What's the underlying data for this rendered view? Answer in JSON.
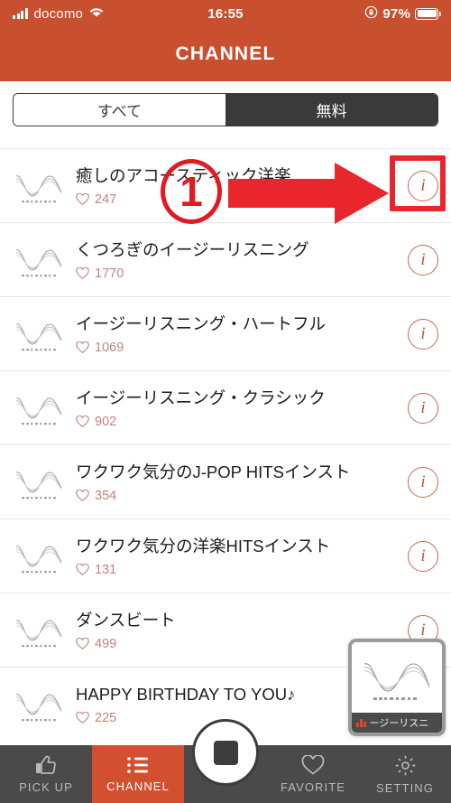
{
  "status_bar": {
    "carrier": "docomo",
    "time": "16:55",
    "battery_percent": "97%",
    "signal_icon": "signal-bars-icon",
    "wifi_icon": "wifi-icon",
    "rotation_lock_icon": "rotation-lock-icon",
    "battery_icon": "battery-icon"
  },
  "header": {
    "title": "CHANNEL"
  },
  "segmented": {
    "selected": "すべて",
    "options": [
      {
        "label": "すべて",
        "selected": true
      },
      {
        "label": "無料",
        "selected": false
      }
    ]
  },
  "channels": [
    {
      "title": "癒しのアコースティック洋楽",
      "likes": "247",
      "info_label": "i"
    },
    {
      "title": "くつろぎのイージーリスニング",
      "likes": "1770",
      "info_label": "i"
    },
    {
      "title": "イージーリスニング・ハートフル",
      "likes": "1069",
      "info_label": "i"
    },
    {
      "title": "イージーリスニング・クラシック",
      "likes": "902",
      "info_label": "i"
    },
    {
      "title": "ワクワク気分のJ-POP HITSインスト",
      "likes": "354",
      "info_label": "i"
    },
    {
      "title": "ワクワク気分の洋楽HITSインスト",
      "likes": "131",
      "info_label": "i"
    },
    {
      "title": "ダンスビート",
      "likes": "499",
      "info_label": "i"
    },
    {
      "title": "HAPPY BIRTHDAY TO YOU♪",
      "likes": "225",
      "info_label": "i"
    }
  ],
  "annotations": {
    "step_number": "1",
    "arrow_icon": "red-arrow-right-icon",
    "highlight_box": "red-highlight-rectangle"
  },
  "mini_player": {
    "now_playing": "ージーリスニ",
    "equalizer_icon": "equalizer-icon",
    "artwork_icon": "waveform-logo-icon"
  },
  "tab_bar": {
    "items": [
      {
        "label": "PICK UP",
        "icon": "thumbs-up-icon",
        "active": false
      },
      {
        "label": "CHANNEL",
        "icon": "list-icon",
        "active": true
      },
      {
        "label": "FAVORITE",
        "icon": "heart-icon",
        "active": false
      },
      {
        "label": "SETTING",
        "icon": "gear-icon",
        "active": false
      }
    ],
    "stop_button": "stop-button"
  },
  "colors": {
    "brand_orange": "#c9502f",
    "tab_active": "#d2502f",
    "tab_bg": "#4a4a4a",
    "annotation_red": "#e11b22",
    "like_rose": "#c4837c"
  }
}
